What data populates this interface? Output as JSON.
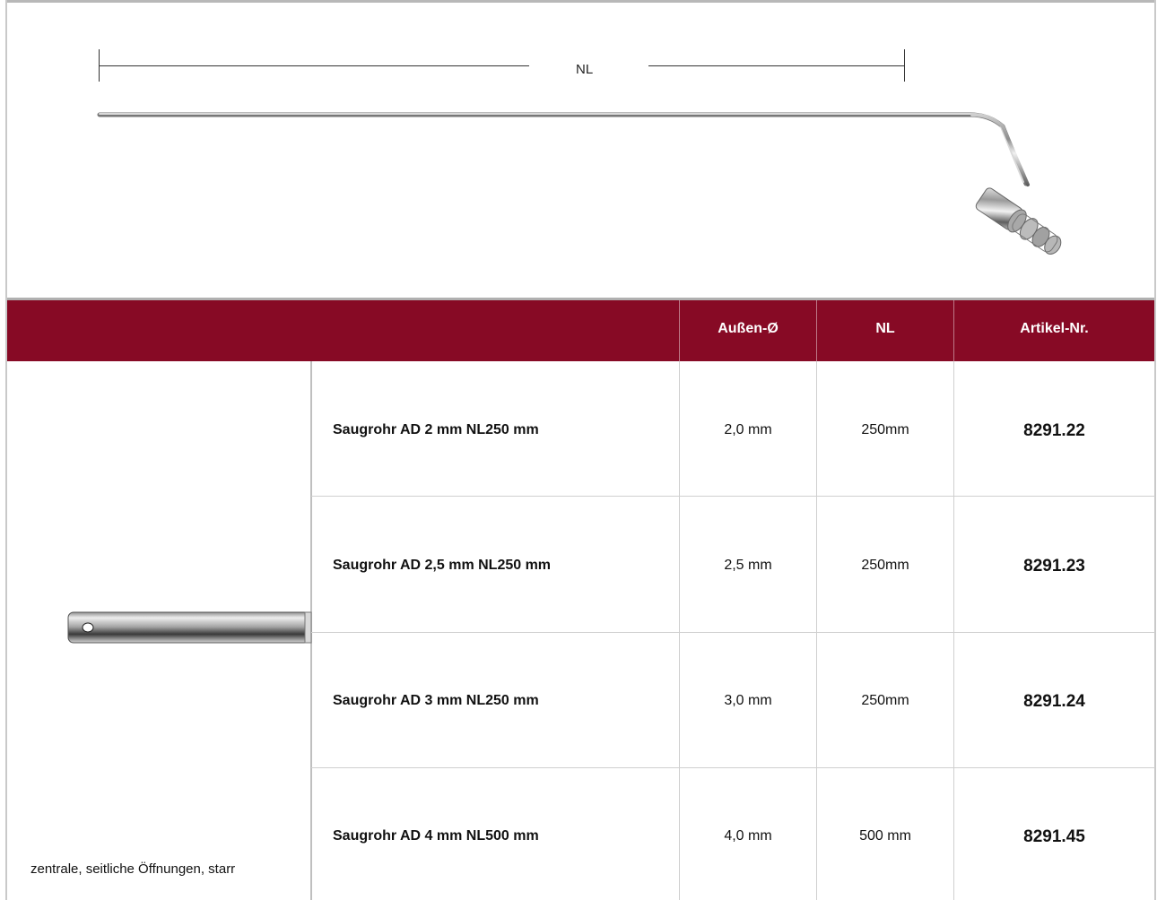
{
  "diagram": {
    "dimension_label": "NL"
  },
  "table": {
    "headers": {
      "blank": "",
      "outer_diameter": "Außen-Ø",
      "length": "NL",
      "article": "Artikel-Nr."
    },
    "left_description": "zentrale, seitliche Öffnungen, starr",
    "rows": [
      {
        "description": "Saugrohr AD 2 mm NL250 mm",
        "outer_diameter": "2,0 mm",
        "length": "250mm",
        "article": "8291.22"
      },
      {
        "description": "Saugrohr AD 2,5 mm NL250 mm",
        "outer_diameter": "2,5 mm",
        "length": "250mm",
        "article": "8291.23"
      },
      {
        "description": "Saugrohr AD 3 mm NL250 mm",
        "outer_diameter": "3,0 mm",
        "length": "250mm",
        "article": "8291.24"
      },
      {
        "description": "Saugrohr AD 4 mm NL500 mm",
        "outer_diameter": "4,0 mm",
        "length": "500 mm",
        "article": "8291.45"
      }
    ]
  },
  "colors": {
    "header_background": "#870a25",
    "header_text": "#ffffff",
    "grid": "#cfcfcf"
  }
}
